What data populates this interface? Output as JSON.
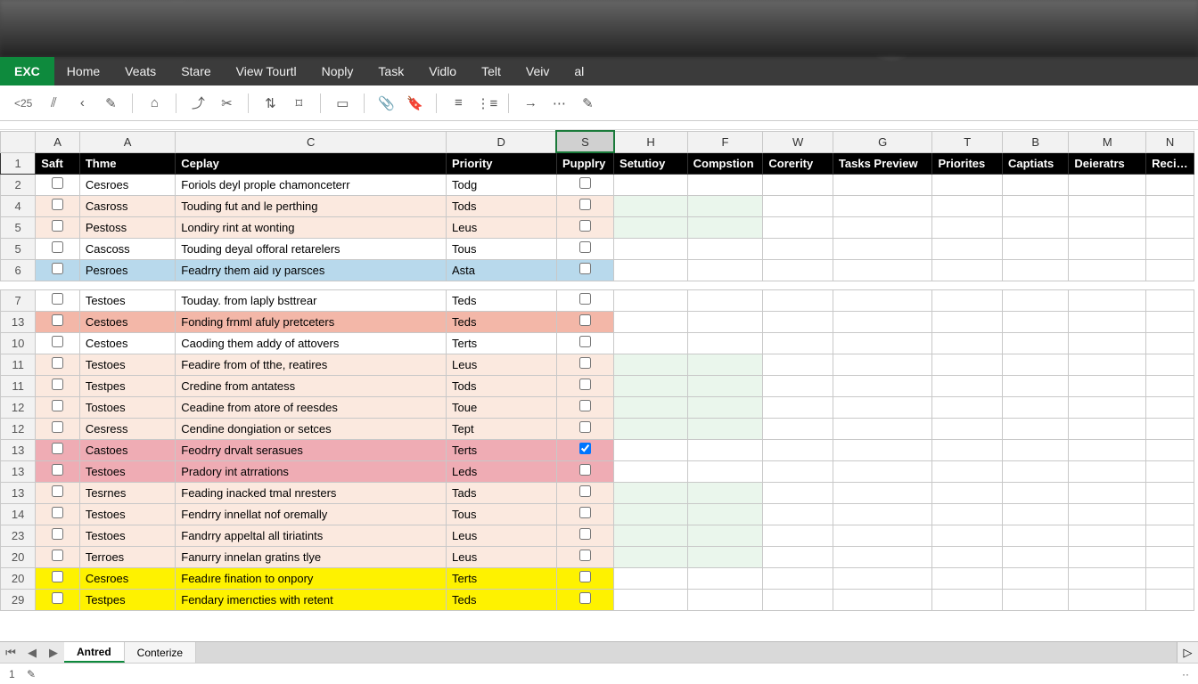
{
  "app": {
    "name": "EXC"
  },
  "menu": [
    "Home",
    "Veats",
    "Stare",
    "View Tourtl",
    "Noply",
    "Task",
    "Vidlo",
    "Telt",
    "Veiv",
    "al"
  ],
  "toolbar": {
    "namebox": "<25",
    "icons": [
      "⫽",
      "‹",
      "✎",
      "⌂",
      "⤴",
      "✂",
      "⇅",
      "⌑",
      "▭",
      "📎",
      "🔖",
      "≡",
      "⋮≡",
      "→",
      "⋯",
      "✎"
    ]
  },
  "columns": [
    "A",
    "A",
    "C",
    "D",
    "S",
    "H",
    "F",
    "W",
    "G",
    "T",
    "B",
    "M",
    "N"
  ],
  "selected_column_index": 4,
  "header_row": {
    "num": "1",
    "cells": [
      "Saft",
      "Thme",
      "Ceplay",
      "Priority",
      "Pupplry",
      "Setutioy",
      "Compstion",
      "Corerity",
      "Tasks    Preview",
      "Priorites",
      "Captiats",
      "Deieratrs",
      "Recime"
    ]
  },
  "rows": [
    {
      "num": "2",
      "a": "Cesroes",
      "c": "Foriols deyl prople chamonceterr",
      "d": "Todg",
      "s": false,
      "fill": "",
      "mint": false
    },
    {
      "num": "4",
      "a": "Casross",
      "c": "Touding fut and le perthing",
      "d": "Tods",
      "s": false,
      "fill": "peach",
      "mint": true
    },
    {
      "num": "5",
      "a": "Pestoss",
      "c": "Londiry rint at wonting",
      "d": "Leus",
      "s": false,
      "fill": "peach",
      "mint": true
    },
    {
      "num": "5",
      "a": "Cascoss",
      "c": "Touding deyal offoral retarelers",
      "d": "Tous",
      "s": false,
      "fill": "",
      "mint": false
    },
    {
      "num": "6",
      "a": "Pesroes",
      "c": "Feadrry them aid ıy parsces",
      "d": "Asta",
      "s": false,
      "fill": "blue",
      "mint": false
    },
    {
      "num": "7",
      "a": "Testoes",
      "c": "Touday. from laply bsttrear",
      "d": "Teds",
      "s": false,
      "fill": "",
      "mint": false
    },
    {
      "num": "13",
      "a": "Cestoes",
      "c": "Fonding frnml afuly pretceters",
      "d": "Teds",
      "s": false,
      "fill": "salmon",
      "mint": false
    },
    {
      "num": "10",
      "a": "Cestoes",
      "c": "Caoding them addy of attovers",
      "d": "Terts",
      "s": false,
      "fill": "",
      "mint": false
    },
    {
      "num": "11",
      "a": "Testoes",
      "c": "Feadire from of tthe, reatires",
      "d": "Leus",
      "s": false,
      "fill": "peach",
      "mint": true
    },
    {
      "num": "11",
      "a": "Testpes",
      "c": "Credine from antatess",
      "d": "Tods",
      "s": false,
      "fill": "peach",
      "mint": true
    },
    {
      "num": "12",
      "a": "Tostoes",
      "c": "Ceadine from atore of reesdes",
      "d": "Toue",
      "s": false,
      "fill": "peach",
      "mint": true
    },
    {
      "num": "12",
      "a": "Cesress",
      "c": "Cendine dongiation or setces",
      "d": "Tept",
      "s": false,
      "fill": "peach",
      "mint": true
    },
    {
      "num": "13",
      "a": "Castoes",
      "c": "Feodrry drvalt serasues",
      "d": "Terts",
      "s": true,
      "fill": "pink",
      "mint": false
    },
    {
      "num": "13",
      "a": "Testoes",
      "c": "Pradory int atrrations",
      "d": "Leds",
      "s": false,
      "fill": "pink",
      "mint": false
    },
    {
      "num": "13",
      "a": "Tesrnes",
      "c": "Feading inacked tmal nresters",
      "d": "Tads",
      "s": false,
      "fill": "peach",
      "mint": true
    },
    {
      "num": "14",
      "a": "Testoes",
      "c": "Fendrry innellat nof oremally",
      "d": "Tous",
      "s": false,
      "fill": "peach",
      "mint": true
    },
    {
      "num": "23",
      "a": "Testoes",
      "c": "Fandrry appeltal all tiriatints",
      "d": "Leus",
      "s": false,
      "fill": "peach",
      "mint": true
    },
    {
      "num": "20",
      "a": "Terroes",
      "c": "Fanurry innelan gratins tlye",
      "d": "Leus",
      "s": false,
      "fill": "peach",
      "mint": true
    },
    {
      "num": "20",
      "a": "Cesroes",
      "c": "Feadıre fination to onpory",
      "d": "Terts",
      "s": false,
      "fill": "yellow",
      "mint": false
    },
    {
      "num": "29",
      "a": "Testpes",
      "c": "Fendary imerıcties with retent",
      "d": "Teds",
      "s": false,
      "fill": "yellow",
      "mint": false
    }
  ],
  "tabs": {
    "nav": [
      "⏮",
      "◀",
      "▶"
    ],
    "items": [
      "Antred",
      "Conterize"
    ],
    "active": 0,
    "end": "▷"
  },
  "status": {
    "left": "1",
    "icon": "✎",
    "right": "··"
  }
}
